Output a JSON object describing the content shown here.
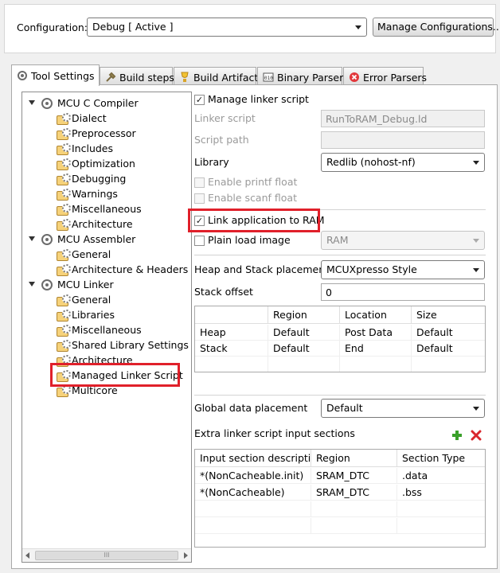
{
  "config": {
    "label": "Configuration:",
    "value": "Debug  [ Active ]",
    "manage_button": "Manage Configurations..."
  },
  "tabs": [
    {
      "label": "Tool Settings",
      "icon": "gear-icon"
    },
    {
      "label": "Build steps",
      "icon": "build-steps-icon"
    },
    {
      "label": "Build Artifact",
      "icon": "build-artifact-icon"
    },
    {
      "label": "Binary Parsers",
      "icon": "binary-parser-icon"
    },
    {
      "label": "Error Parsers",
      "icon": "error-parser-icon"
    }
  ],
  "tree": {
    "compiler": {
      "label": "MCU C Compiler",
      "children": [
        "Dialect",
        "Preprocessor",
        "Includes",
        "Optimization",
        "Debugging",
        "Warnings",
        "Miscellaneous",
        "Architecture"
      ]
    },
    "assembler": {
      "label": "MCU Assembler",
      "children": [
        "General",
        "Architecture & Headers"
      ]
    },
    "linker": {
      "label": "MCU Linker",
      "children": [
        "General",
        "Libraries",
        "Miscellaneous",
        "Shared Library Settings",
        "Architecture",
        "Managed Linker Script",
        "Multicore"
      ]
    },
    "scroll_thumb": "III"
  },
  "form": {
    "manage_linker_script": {
      "label": "Manage linker script",
      "checked": true
    },
    "linker_script": {
      "label": "Linker script",
      "value": "RunToRAM_Debug.ld"
    },
    "script_path": {
      "label": "Script path",
      "value": ""
    },
    "library": {
      "label": "Library",
      "value": "Redlib (nohost-nf)"
    },
    "enable_printf_float": {
      "label": "Enable printf float",
      "checked": false
    },
    "enable_scanf_float": {
      "label": "Enable scanf float",
      "checked": false
    },
    "link_to_ram": {
      "label": "Link application to RAM",
      "checked": true
    },
    "plain_load_image": {
      "label": "Plain load image",
      "checked": false,
      "select": "RAM"
    },
    "heap_stack_placement": {
      "label": "Heap and Stack placement",
      "value": "MCUXpresso Style"
    },
    "stack_offset": {
      "label": "Stack offset",
      "value": "0"
    },
    "heap_stack_table": {
      "headers": [
        "",
        "Region",
        "Location",
        "Size"
      ],
      "rows": [
        [
          "Heap",
          "Default",
          "Post Data",
          "Default"
        ],
        [
          "Stack",
          "Default",
          "End",
          "Default"
        ]
      ]
    },
    "global_data_placement": {
      "label": "Global data placement",
      "value": "Default"
    },
    "extra_sections": {
      "label": "Extra linker script input sections",
      "headers": [
        "Input section descripti...",
        "Region",
        "Section Type"
      ],
      "rows": [
        [
          "*(NonCacheable.init)",
          "SRAM_DTC",
          ".data"
        ],
        [
          "*(NonCacheable)",
          "SRAM_DTC",
          ".bss"
        ]
      ],
      "add_icon": "add-icon",
      "remove_icon": "remove-icon"
    }
  },
  "colors": {
    "highlight": "#e0202a",
    "add": "#3aa02a",
    "remove": "#d9262c"
  }
}
